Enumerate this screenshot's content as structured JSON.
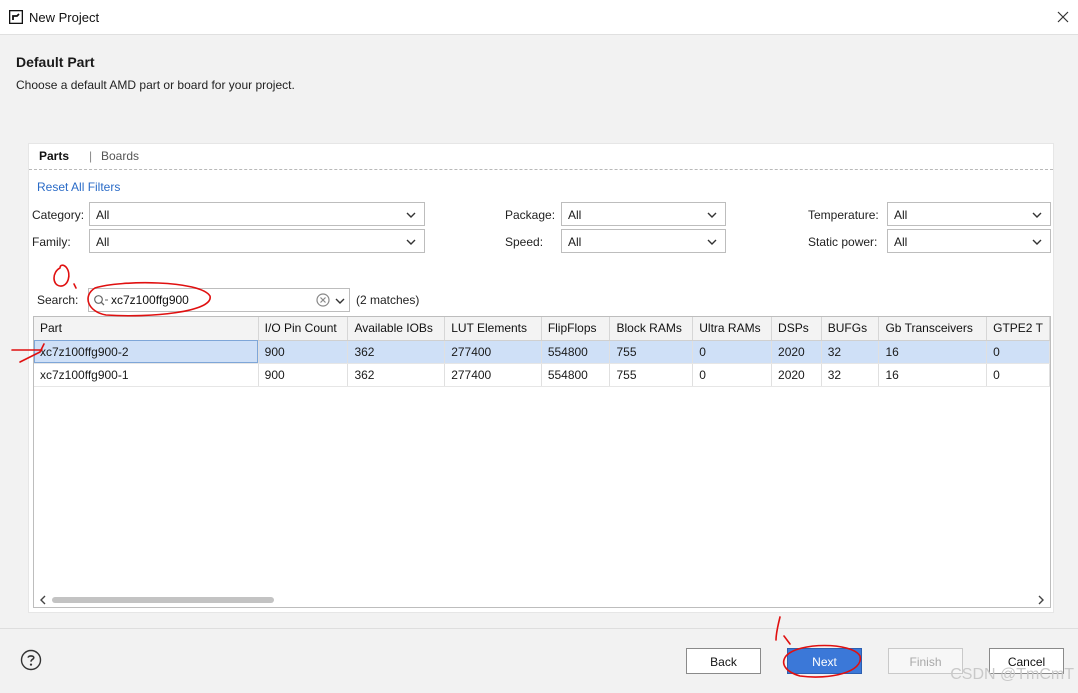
{
  "window": {
    "title": "New Project"
  },
  "header": {
    "title": "Default Part",
    "subtitle": "Choose a default AMD part or board for your project."
  },
  "tabs": [
    {
      "label": "Parts",
      "active": true
    },
    {
      "label": "Boards",
      "active": false
    }
  ],
  "tab_separator": "|",
  "filters": {
    "reset_label": "Reset All Filters",
    "category": {
      "label": "Category:",
      "value": "All"
    },
    "family": {
      "label": "Family:",
      "value": "All"
    },
    "package": {
      "label": "Package:",
      "value": "All"
    },
    "speed": {
      "label": "Speed:",
      "value": "All"
    },
    "temperature": {
      "label": "Temperature:",
      "value": "All"
    },
    "static_power": {
      "label": "Static power:",
      "value": "All"
    }
  },
  "search": {
    "label": "Search:",
    "value": "xc7z100ffg900",
    "matches": "(2 matches)"
  },
  "table": {
    "columns": [
      "Part",
      "I/O Pin Count",
      "Available IOBs",
      "LUT Elements",
      "FlipFlops",
      "Block RAMs",
      "Ultra RAMs",
      "DSPs",
      "BUFGs",
      "Gb Transceivers",
      "GTPE2 T"
    ],
    "rows": [
      [
        "xc7z100ffg900-2",
        "900",
        "362",
        "277400",
        "554800",
        "755",
        "0",
        "2020",
        "32",
        "16",
        "0"
      ],
      [
        "xc7z100ffg900-1",
        "900",
        "362",
        "277400",
        "554800",
        "755",
        "0",
        "2020",
        "32",
        "16",
        "0"
      ]
    ],
    "selected_row": 0
  },
  "buttons": {
    "back": "Back",
    "next": "Next",
    "finish": "Finish",
    "cancel": "Cancel"
  },
  "watermark": "CSDN @TmCmT",
  "colors": {
    "accent": "#3b78d8",
    "selection": "#cfe0f7",
    "link": "#2a6bc7",
    "annotation": "#e01010"
  },
  "icons": {
    "logo": "amd-logo-icon",
    "close": "close-icon",
    "chevron": "chevron-down-icon",
    "search": "search-icon",
    "clear": "clear-circle-icon",
    "help": "help-icon"
  }
}
